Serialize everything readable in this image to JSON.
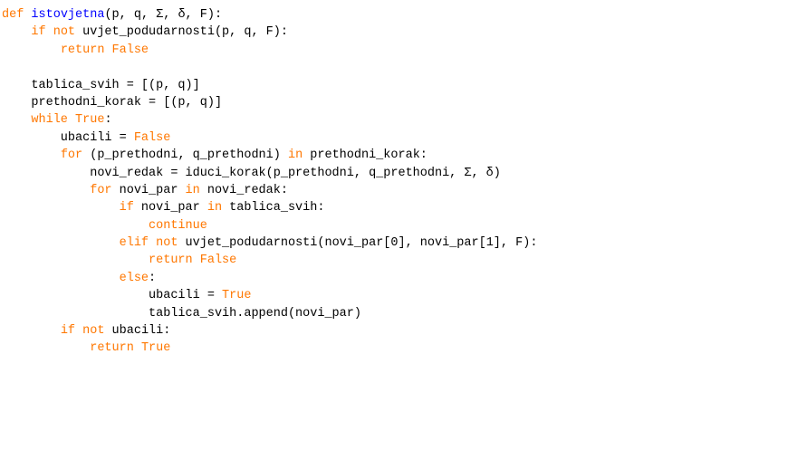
{
  "lines": [
    [
      {
        "t": "def",
        "c": "kw"
      },
      {
        "t": " "
      },
      {
        "t": "istovjetna",
        "c": "def"
      },
      {
        "t": "(p, q, Σ, δ, F):"
      }
    ],
    [
      {
        "t": "    "
      },
      {
        "t": "if",
        "c": "kw"
      },
      {
        "t": " "
      },
      {
        "t": "not",
        "c": "kw"
      },
      {
        "t": " uvjet_podudarnosti(p, q, F):"
      }
    ],
    [
      {
        "t": "        "
      },
      {
        "t": "return",
        "c": "kw"
      },
      {
        "t": " "
      },
      {
        "t": "False",
        "c": "kw"
      }
    ],
    [],
    [
      {
        "t": "    tablica_svih = [(p, q)]"
      }
    ],
    [
      {
        "t": "    prethodni_korak = [(p, q)]"
      }
    ],
    [
      {
        "t": "    "
      },
      {
        "t": "while",
        "c": "kw"
      },
      {
        "t": " "
      },
      {
        "t": "True",
        "c": "kw"
      },
      {
        "t": ":"
      }
    ],
    [
      {
        "t": "        ubacili = "
      },
      {
        "t": "False",
        "c": "kw"
      }
    ],
    [
      {
        "t": "        "
      },
      {
        "t": "for",
        "c": "kw"
      },
      {
        "t": " (p_prethodni, q_prethodni) "
      },
      {
        "t": "in",
        "c": "kw"
      },
      {
        "t": " prethodni_korak:"
      }
    ],
    [
      {
        "t": "            novi_redak = iduci_korak(p_prethodni, q_prethodni, Σ, δ)"
      }
    ],
    [
      {
        "t": "            "
      },
      {
        "t": "for",
        "c": "kw"
      },
      {
        "t": " novi_par "
      },
      {
        "t": "in",
        "c": "kw"
      },
      {
        "t": " novi_redak:"
      }
    ],
    [
      {
        "t": "                "
      },
      {
        "t": "if",
        "c": "kw"
      },
      {
        "t": " novi_par "
      },
      {
        "t": "in",
        "c": "kw"
      },
      {
        "t": " tablica_svih:"
      }
    ],
    [
      {
        "t": "                    "
      },
      {
        "t": "continue",
        "c": "kw"
      }
    ],
    [
      {
        "t": "                "
      },
      {
        "t": "elif",
        "c": "kw"
      },
      {
        "t": " "
      },
      {
        "t": "not",
        "c": "kw"
      },
      {
        "t": " uvjet_podudarnosti(novi_par[0], novi_par[1], F):"
      }
    ],
    [
      {
        "t": "                    "
      },
      {
        "t": "return",
        "c": "kw"
      },
      {
        "t": " "
      },
      {
        "t": "False",
        "c": "kw"
      }
    ],
    [
      {
        "t": "                "
      },
      {
        "t": "else",
        "c": "kw"
      },
      {
        "t": ":"
      }
    ],
    [
      {
        "t": "                    ubacili = "
      },
      {
        "t": "True",
        "c": "kw"
      }
    ],
    [
      {
        "t": "                    tablica_svih.append(novi_par)"
      }
    ],
    [
      {
        "t": "        "
      },
      {
        "t": "if",
        "c": "kw"
      },
      {
        "t": " "
      },
      {
        "t": "not",
        "c": "kw"
      },
      {
        "t": " ubacili:"
      }
    ],
    [
      {
        "t": "            "
      },
      {
        "t": "return",
        "c": "kw"
      },
      {
        "t": " "
      },
      {
        "t": "True",
        "c": "kw"
      }
    ]
  ],
  "colors": {
    "keyword": "#ff7700",
    "definition": "#0000ff",
    "text": "#000000",
    "background": "#ffffff"
  }
}
